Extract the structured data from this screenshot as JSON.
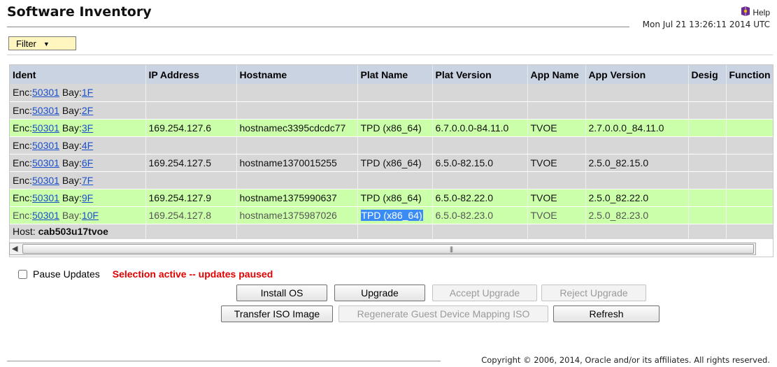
{
  "page": {
    "title": "Software Inventory",
    "help_label": "Help",
    "timestamp": "Mon Jul 21 13:26:11 2014 UTC",
    "filter_label": "Filter"
  },
  "grid": {
    "columns": [
      "Ident",
      "IP Address",
      "Hostname",
      "Plat Name",
      "Plat Version",
      "App Name",
      "App Version",
      "Desig",
      "Function"
    ],
    "rows": [
      {
        "enc_label": "Enc:",
        "enc": "50301",
        "bay_label": "Bay:",
        "bay": "1F",
        "ip": "",
        "hostname": "",
        "plat_name": "",
        "plat_version": "",
        "app_name": "",
        "app_version": ""
      },
      {
        "enc_label": "Enc:",
        "enc": "50301",
        "bay_label": "Bay:",
        "bay": "2F",
        "ip": "",
        "hostname": "",
        "plat_name": "",
        "plat_version": "",
        "app_name": "",
        "app_version": ""
      },
      {
        "enc_label": "Enc:",
        "enc": "50301",
        "bay_label": "Bay:",
        "bay": "3F",
        "ip": "169.254.127.6",
        "hostname": "hostnamec3395cdcdc77",
        "plat_name": "TPD (x86_64)",
        "plat_version": "6.7.0.0.0-84.11.0",
        "app_name": "TVOE",
        "app_version": "2.7.0.0.0_84.11.0"
      },
      {
        "enc_label": "Enc:",
        "enc": "50301",
        "bay_label": "Bay:",
        "bay": "4F",
        "ip": "",
        "hostname": "",
        "plat_name": "",
        "plat_version": "",
        "app_name": "",
        "app_version": ""
      },
      {
        "enc_label": "Enc:",
        "enc": "50301",
        "bay_label": "Bay:",
        "bay": "6F",
        "ip": "169.254.127.5",
        "hostname": "hostname1370015255",
        "plat_name": "TPD (x86_64)",
        "plat_version": "6.5.0-82.15.0",
        "app_name": "TVOE",
        "app_version": "2.5.0_82.15.0"
      },
      {
        "enc_label": "Enc:",
        "enc": "50301",
        "bay_label": "Bay:",
        "bay": "7F",
        "ip": "",
        "hostname": "",
        "plat_name": "",
        "plat_version": "",
        "app_name": "",
        "app_version": ""
      },
      {
        "enc_label": "Enc:",
        "enc": "50301",
        "bay_label": "Bay:",
        "bay": "9F",
        "ip": "169.254.127.9",
        "hostname": "hostname1375990637",
        "plat_name": "TPD (x86_64)",
        "plat_version": "6.5.0-82.22.0",
        "app_name": "TVOE",
        "app_version": "2.5.0_82.22.0"
      },
      {
        "enc_label": "Enc:",
        "enc": "50301",
        "bay_label": "Bay:",
        "bay": "10F",
        "ip": "169.254.127.8",
        "hostname": "hostname1375987026",
        "plat_name": "TPD (x86_64)",
        "plat_version": "6.5.0-82.23.0",
        "app_name": "TVOE",
        "app_version": "2.5.0_82.23.0"
      }
    ],
    "host_row": {
      "host_label": "Host:",
      "host_name": "cab503u17tvoe"
    }
  },
  "controls": {
    "pause_label": "Pause Updates",
    "pause_message": "Selection active -- updates paused",
    "install_os": "Install OS",
    "upgrade": "Upgrade",
    "accept_upgrade": "Accept Upgrade",
    "reject_upgrade": "Reject Upgrade",
    "transfer_iso": "Transfer ISO Image",
    "regenerate_iso": "Regenerate Guest Device Mapping ISO",
    "refresh": "Refresh"
  },
  "footer": {
    "copyright": "Copyright © 2006, 2014, Oracle and/or its affiliates. All rights reserved."
  },
  "colors": {
    "header_bg": "#c9d3e1",
    "row_gray": "#d7d7d7",
    "row_green": "#ccffaa",
    "filter_bg": "#fff5bf",
    "warning_red": "#e00000",
    "link_blue": "#1a4fcc",
    "selection_blue": "#3a8cf4"
  }
}
